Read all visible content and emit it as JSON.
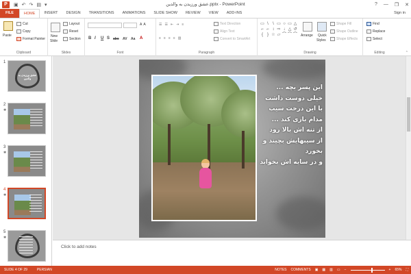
{
  "titlebar": {
    "app_icon": "P",
    "title": "عشق ورزیدن به والدین.pptx - PowerPoint",
    "qat": [
      "save-icon",
      "undo-icon",
      "redo-icon",
      "present-icon",
      "customize-icon"
    ],
    "controls": [
      "?",
      "—",
      "❐",
      "✕"
    ]
  },
  "tabs": {
    "file": "FILE",
    "items": [
      "HOME",
      "INSERT",
      "DESIGN",
      "TRANSITIONS",
      "ANIMATIONS",
      "SLIDE SHOW",
      "REVIEW",
      "VIEW",
      "ADD-INS"
    ],
    "active": "HOME",
    "signin": "Sign in"
  },
  "ribbon": {
    "clipboard": {
      "paste": "Paste",
      "cut": "Cut",
      "copy": "Copy",
      "format_painter": "Format Painter",
      "label": "Clipboard"
    },
    "slides": {
      "new_slide": "New",
      "new_slide2": "Slide",
      "layout": "Layout",
      "reset": "Reset",
      "section": "Section",
      "label": "Slides"
    },
    "font": {
      "bold": "B",
      "italic": "I",
      "underline": "U",
      "strike": "S",
      "shadow": "abc",
      "spacing": "AV",
      "case": "Aa",
      "font_color": "A",
      "label": "Font"
    },
    "paragraph": {
      "text_direction": "Text Direction",
      "align_text": "Align Text",
      "smartart": "Convert to SmartArt",
      "label": "Paragraph"
    },
    "drawing": {
      "shapes": [
        "▭",
        "\\",
        "\\",
        "▭",
        "○",
        "▭",
        "△",
        "⌐",
        "⌐",
        "↕",
        "⇨",
        "↓",
        "△",
        "↺",
        "{",
        "}",
        "☆",
        "▱",
        "⌒",
        "⌒",
        "⌒"
      ],
      "arrange": "Arrange",
      "quick_styles": "Quick",
      "quick_styles2": "Styles",
      "shape_fill": "Shape Fill",
      "shape_outline": "Shape Outline",
      "shape_effects": "Shape Effects",
      "label": "Drawing"
    },
    "editing": {
      "find": "Find",
      "replace": "Replace",
      "select": "Select",
      "label": "Editing"
    }
  },
  "slides_panel": {
    "slides": [
      {
        "num": "1",
        "caption": "عشق ورزیدن به والدین"
      },
      {
        "num": "2"
      },
      {
        "num": "3"
      },
      {
        "num": "4"
      },
      {
        "num": "5"
      }
    ],
    "current": "4"
  },
  "slide": {
    "lines": [
      "این پسر بچه ...",
      "خیلی دوست داشت",
      "با این درخت سیب",
      "مدام بازی کند ...",
      "از تنه اش بالا رود",
      "از سیبهایش بچیند و",
      "بخورد",
      "و در سایه اش بخوابد"
    ]
  },
  "notes": {
    "placeholder": "Click to add notes"
  },
  "status": {
    "slide_info": "SLIDE 4 OF 29",
    "language": "PERSIAN",
    "notes": "NOTES",
    "comments": "COMMENTS",
    "zoom": "65%",
    "zoom_level": 0.65
  },
  "colors": {
    "accent": "#d24726",
    "child_dress": "#e6559f"
  }
}
